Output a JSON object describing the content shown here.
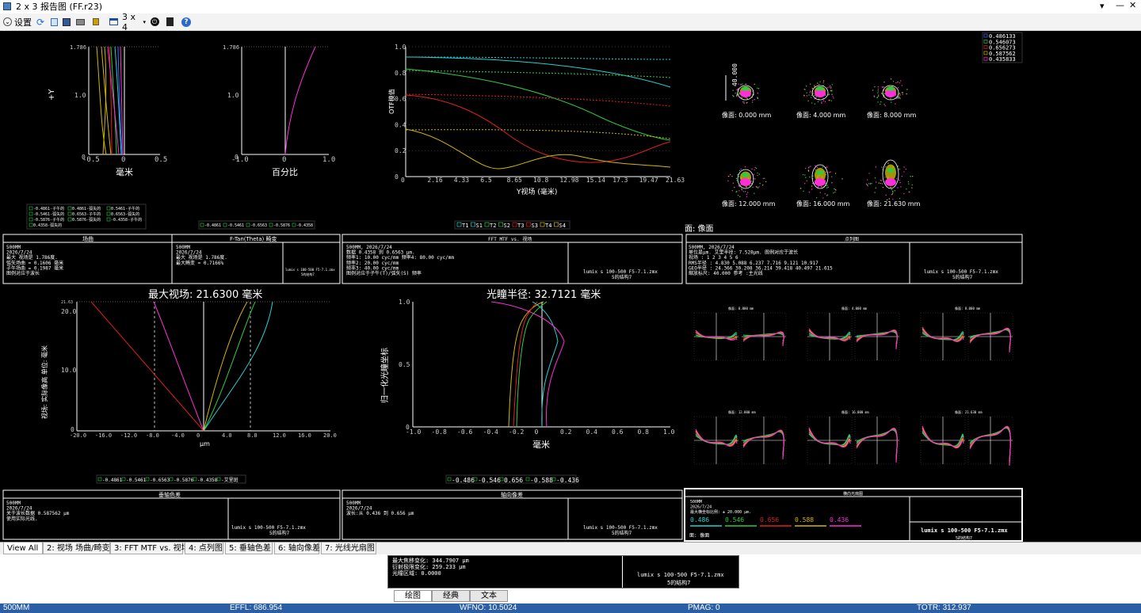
{
  "window": {
    "title": "2 x 3 报告图 (FF.r23)"
  },
  "toolbar": {
    "settings": "设置",
    "layout": "3 x 4"
  },
  "p_fc": {
    "xlabel": "毫米",
    "ylabel": "+Y",
    "xticks": [
      "-0.5",
      "0",
      "0.5"
    ],
    "yticks": [
      "1.786",
      "1.0",
      "0"
    ],
    "legend": [
      "-0.4861-子午的",
      "0.4861-弧矢的",
      "0.5461-子午的",
      "-0.5461-弧矢的",
      "0.6563-子午的",
      "0.6563-弧矢的",
      "-0.5876-子午的",
      "0.5876-弧矢的",
      "-0.4358-子午的",
      "0.4358-弧矢的"
    ]
  },
  "p_dist": {
    "xlabel": "百分比",
    "xticks": [
      "-1.0",
      "0",
      "1.0"
    ],
    "yticks": [
      "1.786",
      "1.0",
      "0"
    ],
    "legend": [
      "-0.4861",
      "-0.5461",
      "-0.6563",
      "-0.5876",
      "-0.4358"
    ]
  },
  "p_mtf": {
    "xlabel": "Y视场 (毫米)",
    "ylabel": "OTF模值",
    "xticks": [
      "0",
      "2.16",
      "4.33",
      "6.5",
      "8.65",
      "10.8",
      "12.98",
      "15.14",
      "17.3",
      "19.47",
      "21.63"
    ],
    "yticks": [
      "1.0",
      "0.8",
      "0.6",
      "0.4",
      "0.2",
      "0"
    ],
    "legend": [
      "T1",
      "S1",
      "T2",
      "S2",
      "T3",
      "S3",
      "T4",
      "S4"
    ]
  },
  "p_spot": {
    "field_labels": [
      "像面: 0.000 mm",
      "像面: 4.000 mm",
      "像面: 8.000 mm",
      "像面: 12.000 mm",
      "像面: 16.000 mm",
      "像面: 21.630 mm"
    ],
    "scale_label": "40.000",
    "bottom_label": "面: 像面",
    "legend": [
      "0.486133",
      "0.546073",
      "0.656273",
      "0.587562",
      "0.435833"
    ]
  },
  "p_lat": {
    "title": "最大视场: 21.6300 毫米",
    "xlabel": "µm",
    "ylabel": "视场: 实际像高 单位: 毫米",
    "xticks": [
      "-20.0",
      "-16.0",
      "-12.0",
      "-8.0",
      "-4.0",
      "0",
      "4.0",
      "8.0",
      "12.0",
      "16.0",
      "20.0"
    ],
    "yticks": [
      "21.63",
      "20.0",
      "10.0",
      "0"
    ],
    "legend": [
      "-0.4861",
      "-0.5461",
      "-0.6563",
      "-0.5876",
      "-0.4358",
      "-艾里斑"
    ]
  },
  "p_axial": {
    "title": "光瞳半径: 32.7121 毫米",
    "xlabel": "毫米",
    "ylabel": "归一化光瞳坐标",
    "xticks": [
      "-1.0",
      "-0.8",
      "-0.6",
      "-0.4",
      "-0.2",
      "0",
      "0.2",
      "0.4",
      "0.6",
      "0.8",
      "1.0"
    ],
    "yticks": [
      "1.0",
      "0.5",
      "0"
    ],
    "legend": [
      "-0.486",
      "-0.546",
      "0.656",
      "-0.588",
      "-0.436"
    ]
  },
  "p_fan": {
    "field_labels": [
      "像面: 0.000 mm",
      "像面: 4.000 mm",
      "像面: 8.000 mm",
      "像面: 12.000 mm",
      "像面: 16.000 mm",
      "像面: 21.630 mm"
    ]
  },
  "box_fc": {
    "title1": "场曲",
    "title2": "F-Tan(Theta) 畸变",
    "lines1": [
      "500MM",
      "2026/7/24",
      "最大 视场是 1.786度.",
      "弧矢场曲 = 0.1606 毫米",
      "子午场曲 = 0.1987 毫米",
      "图例对应于波长"
    ],
    "lines2": [
      "500MM",
      "2026/7/24",
      "最大 视场是 1.786度.",
      "最大畸变 = 0.7166%"
    ],
    "file": "lumix s 100-500 F5-7.1.zmx",
    "config": "5的结构7"
  },
  "box_mtf": {
    "title": "FFT MTF vs. 视场",
    "lines": [
      "500MM, 2026/7/24",
      "数据 0.4358 到 0.6563 µm.",
      "频率1:   10.00 cyc/mm  频率4:   80.00 cyc/mm",
      "频率2:   20.00 cyc/mm",
      "频率3:   40.00 cyc/mm",
      "图例对应于子午(T)/弧矢(S) 频率"
    ],
    "file": "lumix s 100-500 F5-7.1.zmx",
    "config": "5的结构7"
  },
  "box_spot": {
    "title": "点列图",
    "lines": [
      "500MM, 2026/7/24",
      "单位是µm.             艾里半径: 7.528µm. 图例对应于波长",
      "视场   :      1       2       3       4       5       6",
      "RMS半径 :   4.830   5.088   6.237   7.716   9.121  10.917",
      "GEO半径 :  24.366  30.208  36.214  39.418  40.497  21.615",
      "缩放标尺:   40.000     参考  :主光线"
    ],
    "file": "lumix s 100-500 F5-7.1.zmx",
    "config": "5的结构7"
  },
  "box_lat": {
    "title": "垂轴色差",
    "lines": [
      "500MM",
      "2026/7/24",
      "关于波长数据 0.587562 µm",
      "使用实际光线."
    ],
    "file": "lumix s 100-500 F5-7.1.zmx",
    "config": "5的结构7"
  },
  "box_axial": {
    "title": "轴向像差",
    "lines": [
      "500MM",
      "2026/7/24",
      "波长:从 0.436 到 0.656 µm"
    ],
    "file": "lumix s 100-500 F5-7.1.zmx",
    "config": "5的结构7"
  },
  "box_fan": {
    "title": "横向光扇图",
    "lines": [
      "500MM",
      "2026/7/24",
      "最大横坐标比例: ± 20.000 µm."
    ],
    "waves": [
      "0.486",
      "0.546",
      "0.656",
      "0.588",
      "0.436"
    ],
    "surface": "面: 像面",
    "file": "lumix s 100-500 F5-7.1.zmx",
    "config": "5的结构7"
  },
  "tabs": [
    "View All",
    "2: 视场 场曲/畸变",
    "3: FFT MTF vs. 视场",
    "4: 点列图",
    "5: 垂轴色差",
    "6: 轴向像差",
    "7: 光线光扇图"
  ],
  "lower": {
    "lines": [
      "最大焦移变化: 344.7907 µm",
      "衍射极限变化: 259.233 µm",
      "光瞳区域: 0.0000"
    ],
    "file": "lumix s 100-500 F5-7.1.zmx",
    "config": "5的结构7",
    "tabs": [
      "绘图",
      "经典",
      "文本"
    ]
  },
  "status": {
    "s1": "500MM",
    "s2": "EFFL: 686.954",
    "s3": "WFNO: 10.5024",
    "s4": "PMAG: 0",
    "s5": "TOTR: 312.937"
  },
  "colors": {
    "blue": "#3b6cff",
    "green": "#2ecc40",
    "red": "#e02020",
    "yellow": "#d4b800",
    "magenta": "#ff2ed6",
    "cyan": "#1fd4d4"
  }
}
